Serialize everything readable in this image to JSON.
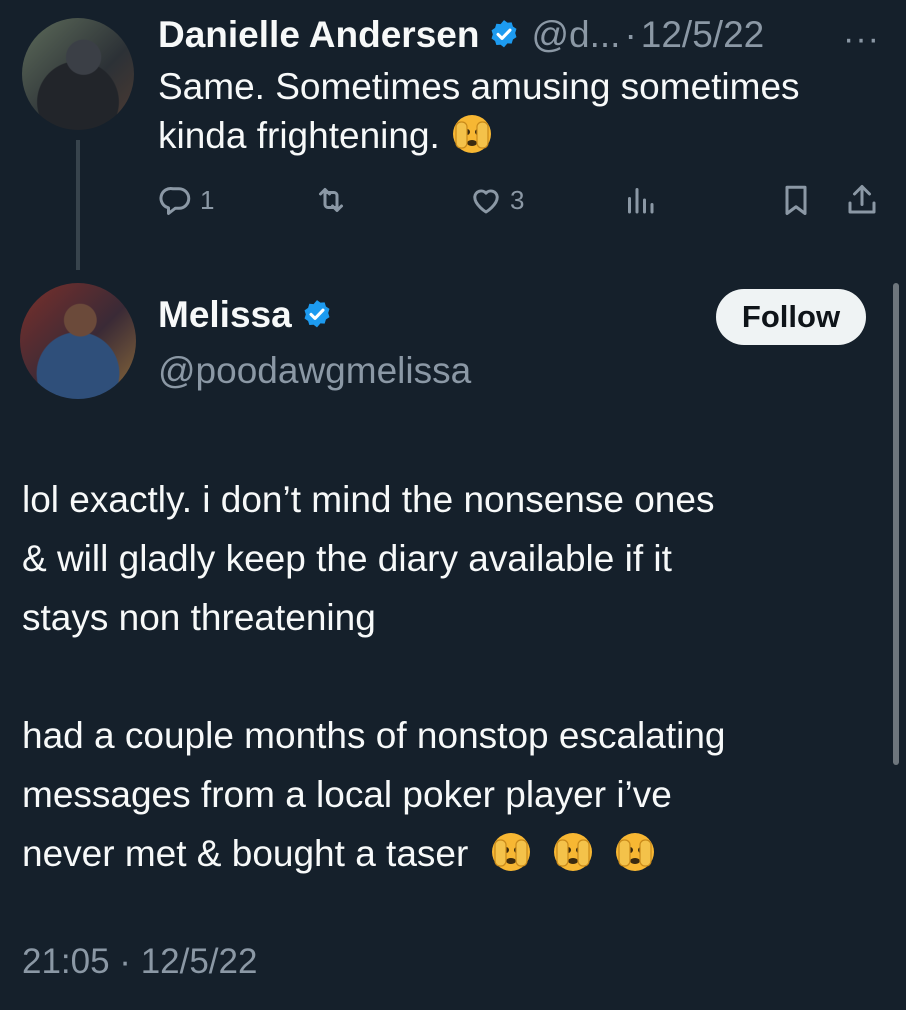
{
  "colors": {
    "background": "#15202b",
    "text": "#f7f9f9",
    "secondary": "#8b98a5",
    "verified": "#1d9bf0"
  },
  "parent_tweet": {
    "author": "Danielle Andersen",
    "handle": "@d...",
    "separator": "·",
    "date": "12/5/22",
    "text_line1": "Same. Sometimes amusing sometimes",
    "text_line2": "kinda frightening.",
    "emoji": "face-with-peeking-eye",
    "replies": "1",
    "likes": "3",
    "more": "···"
  },
  "main_tweet": {
    "author": "Melissa",
    "handle": "@poodawgmelissa",
    "follow_label": "Follow",
    "paragraph1_line1": "lol exactly. i don’t mind the nonsense ones",
    "paragraph1_line2": "& will gladly keep the diary available if it",
    "paragraph1_line3": "stays non threatening",
    "paragraph2_line1": "had a couple months of nonstop escalating",
    "paragraph2_line2": "messages from a local poker player i’ve",
    "paragraph2_line3": "never met & bought a taser",
    "trailing_emojis": [
      "face-with-peeking-eye",
      "face-with-peeking-eye",
      "face-with-peeking-eye"
    ],
    "timestamp": "21:05 · 12/5/22"
  }
}
